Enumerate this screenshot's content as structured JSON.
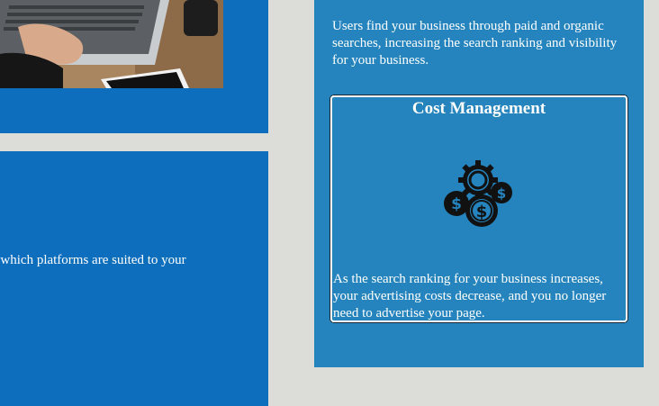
{
  "left": {
    "photo": "laptop-photo",
    "text": "e which platforms are suited to your"
  },
  "right": {
    "intro": "Users find your business through paid and organic searches, increasing the search ranking and visibility for your business.",
    "card": {
      "title": "Cost Management",
      "icon": "gear-money-icon",
      "text": "As the search ranking for your business increases, your advertising costs decrease, and you no longer need to advertise your page."
    }
  },
  "colors": {
    "background": "#dcdcd9",
    "left_panel": "#0d6ebd",
    "right_panel": "#2584bd",
    "text": "#ffffff"
  }
}
